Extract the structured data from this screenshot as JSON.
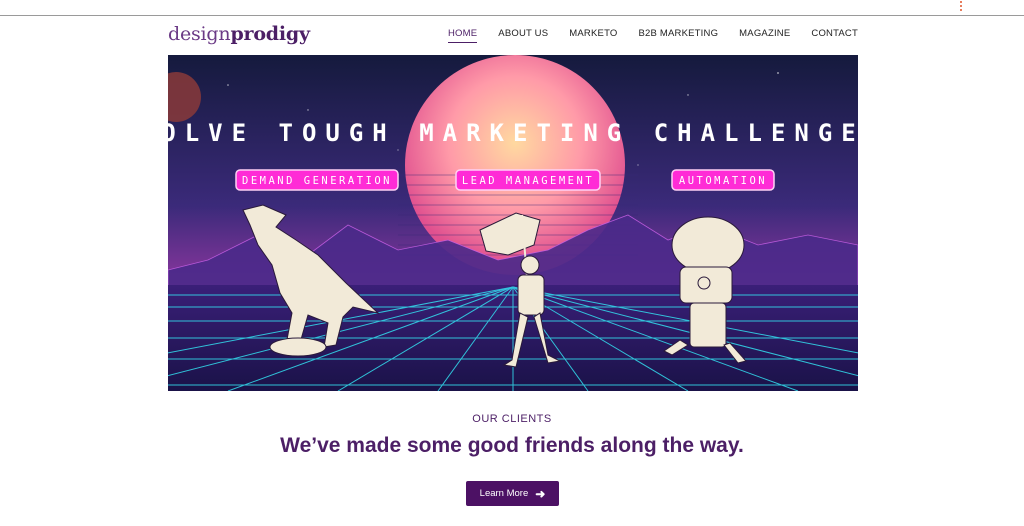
{
  "header": {
    "logo_light": "design",
    "logo_bold": "prodigy",
    "nav": [
      "HOME",
      "ABOUT US",
      "MARKETO",
      "B2B MARKETING",
      "MAGAZINE",
      "CONTACT"
    ]
  },
  "hero": {
    "headline": "SOLVE TOUGH MARKETING CHALLENGES",
    "tags": [
      "DEMAND GENERATION",
      "LEAD MANAGEMENT",
      "AUTOMATION"
    ]
  },
  "clients": {
    "label": "OUR CLIENTS",
    "heading": "We’ve made some good friends along the way.",
    "button": "Learn More"
  },
  "colors": {
    "brand": "#4c1f66",
    "button": "#4c1164",
    "neon_magenta": "#ff2bd6",
    "grid_cyan": "#33e0f0"
  },
  "icons": [
    "kebab-menu-icon",
    "arrow-right-icon"
  ]
}
